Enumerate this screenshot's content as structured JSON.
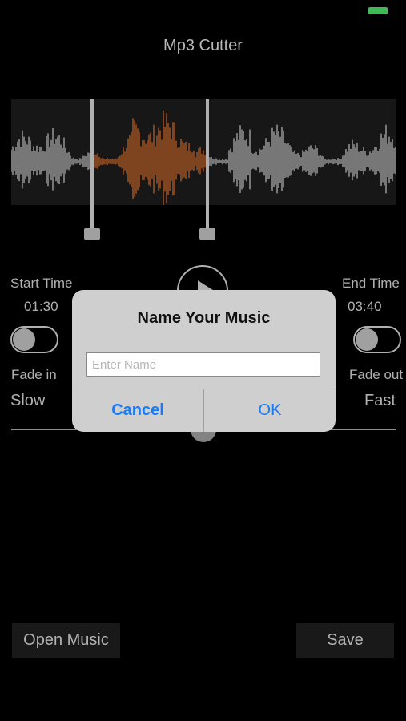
{
  "app": {
    "title": "Mp3 Cutter"
  },
  "colors": {
    "selection": "#c8672a",
    "waveform": "#bdbdbd",
    "battery": "#4cd964",
    "accent": "#1a7cf5"
  },
  "start": {
    "label": "Start Time",
    "time": "01:30",
    "fade_label": "Fade in",
    "fade_on": false
  },
  "end": {
    "label": "End Time",
    "time": "03:40",
    "fade_label": "Fade out",
    "fade_on": false
  },
  "speed": {
    "min_label": "Slow",
    "max_label": "Fast",
    "value": 0.5
  },
  "buttons": {
    "open_music": "Open Music",
    "save": "Save"
  },
  "dialog": {
    "title": "Name Your Music",
    "input_placeholder": "Enter Name",
    "input_value": "",
    "cancel": "Cancel",
    "ok": "OK"
  }
}
